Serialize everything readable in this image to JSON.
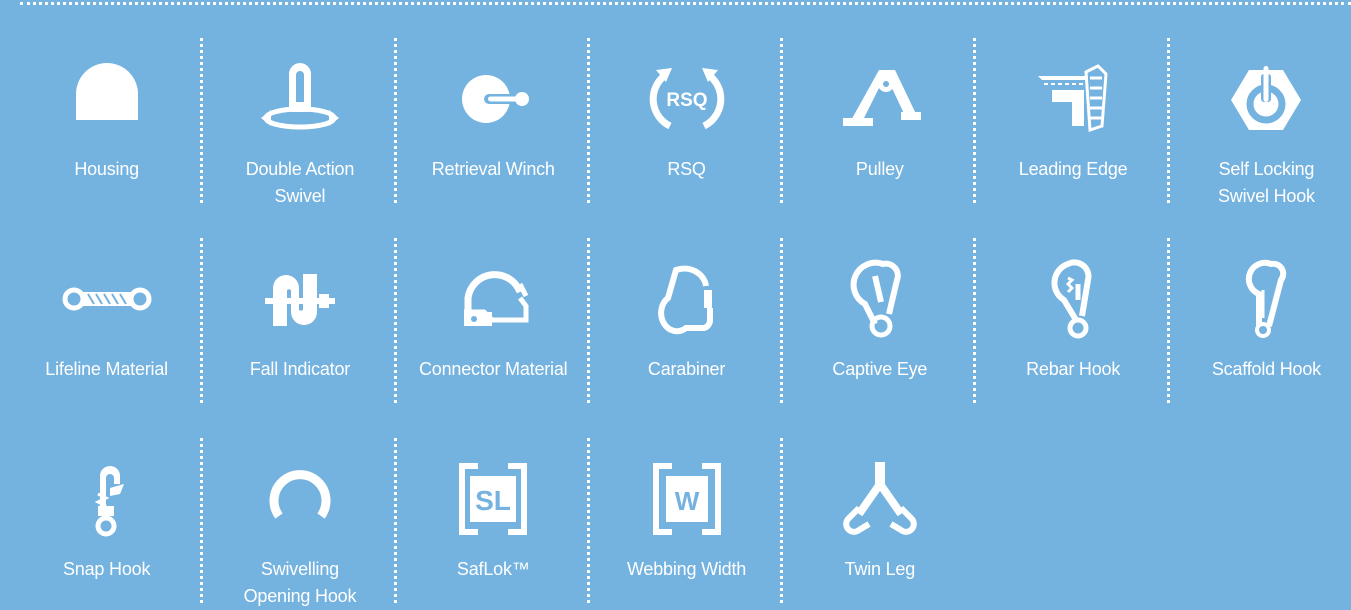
{
  "icons": [
    {
      "name": "housing-icon",
      "label": "Housing"
    },
    {
      "name": "double-action-swivel-icon",
      "label": "Double Action\nSwivel"
    },
    {
      "name": "retrieval-winch-icon",
      "label": "Retrieval Winch"
    },
    {
      "name": "rsq-icon",
      "label": "RSQ",
      "glyph_text": "RSQ"
    },
    {
      "name": "pulley-icon",
      "label": "Pulley"
    },
    {
      "name": "leading-edge-icon",
      "label": "Leading Edge"
    },
    {
      "name": "self-locking-swivel-hook-icon",
      "label": "Self Locking\nSwivel Hook"
    },
    {
      "name": "lifeline-material-icon",
      "label": "Lifeline Material"
    },
    {
      "name": "fall-indicator-icon",
      "label": "Fall Indicator"
    },
    {
      "name": "connector-material-icon",
      "label": "Connector Material"
    },
    {
      "name": "carabiner-icon",
      "label": "Carabiner"
    },
    {
      "name": "captive-eye-icon",
      "label": "Captive Eye"
    },
    {
      "name": "rebar-hook-icon",
      "label": "Rebar Hook"
    },
    {
      "name": "scaffold-hook-icon",
      "label": "Scaffold Hook"
    },
    {
      "name": "snap-hook-icon",
      "label": "Snap Hook"
    },
    {
      "name": "swivelling-opening-hook-icon",
      "label": "Swivelling\nOpening Hook"
    },
    {
      "name": "saflok-icon",
      "label": "SafLok™",
      "glyph_text": "SL"
    },
    {
      "name": "webbing-width-icon",
      "label": "Webbing Width",
      "glyph_text": "W"
    },
    {
      "name": "twin-leg-icon",
      "label": "Twin Leg"
    }
  ],
  "colors": {
    "background": "#74b2e0",
    "foreground": "#ffffff"
  }
}
